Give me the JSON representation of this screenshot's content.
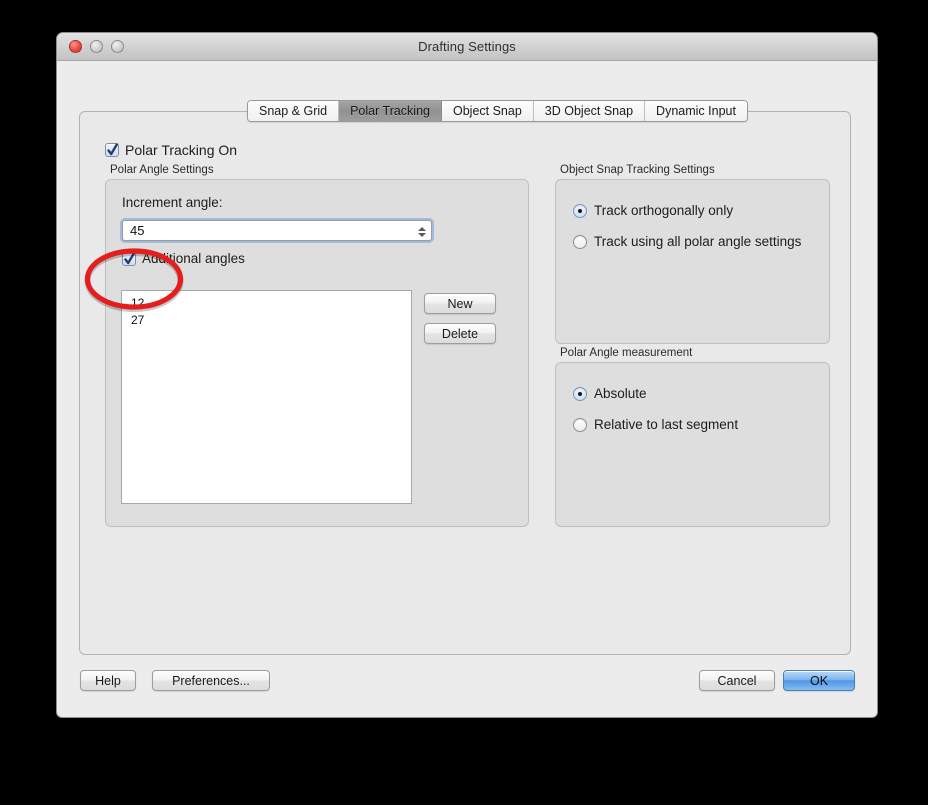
{
  "window": {
    "title": "Drafting Settings",
    "traffic_lights": [
      "close-button",
      "minimize-button",
      "zoom-button"
    ]
  },
  "tabs": [
    {
      "label": "Snap & Grid",
      "active": false
    },
    {
      "label": "Polar Tracking",
      "active": true
    },
    {
      "label": "Object Snap",
      "active": false
    },
    {
      "label": "3D Object Snap",
      "active": false
    },
    {
      "label": "Dynamic Input",
      "active": false
    }
  ],
  "polar_tracking_on": {
    "label": "Polar Tracking On",
    "checked": true
  },
  "polar_angle_settings": {
    "group_label": "Polar Angle Settings",
    "increment_angle_label": "Increment angle:",
    "increment_angle_value": "45",
    "additional_angles": {
      "label": "Additional angles",
      "checked": true
    },
    "angle_list": [
      "12",
      "27"
    ],
    "new_button": "New",
    "delete_button": "Delete"
  },
  "object_snap_tracking_settings": {
    "group_label": "Object Snap Tracking Settings",
    "options": [
      {
        "label": "Track orthogonally only",
        "selected": true
      },
      {
        "label": "Track using all polar angle settings",
        "selected": false
      }
    ]
  },
  "polar_angle_measurement": {
    "group_label": "Polar Angle measurement",
    "options": [
      {
        "label": "Absolute",
        "selected": true
      },
      {
        "label": "Relative to last segment",
        "selected": false
      }
    ]
  },
  "bottom_bar": {
    "help": "Help",
    "preferences": "Preferences...",
    "cancel": "Cancel",
    "ok": "OK"
  },
  "annotation": {
    "shape": "ellipse",
    "color": "#e41e1e",
    "target": "angle-list-values"
  },
  "colors": {
    "desktop_background": "#000000",
    "window_chrome": "#ebebeb",
    "panel": "#e9e9e9",
    "groupbox": "#dedede",
    "accent_blue": "#4e97e6",
    "annotation_red": "#e41e1e"
  }
}
